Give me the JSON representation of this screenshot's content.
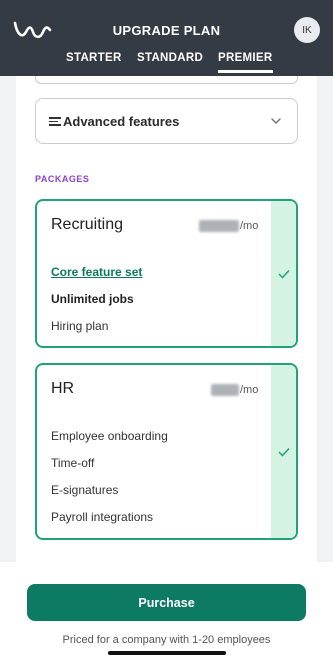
{
  "header": {
    "title": "UPGRADE PLAN",
    "avatar_initials": "IK",
    "tabs": [
      {
        "label": "STARTER",
        "active": false
      },
      {
        "label": "STANDARD",
        "active": false
      },
      {
        "label": "PREMIER",
        "active": true
      }
    ]
  },
  "advanced": {
    "label": "Advanced features",
    "icon": "list-icon",
    "chevron": "chevron-down-icon"
  },
  "packages": {
    "section_label": "PACKAGES",
    "items": [
      {
        "name": "Recruiting",
        "price_suffix": "/mo",
        "selected": true,
        "features": [
          "Core feature set",
          "Unlimited jobs",
          "Hiring plan"
        ]
      },
      {
        "name": "HR",
        "price_suffix": "/mo",
        "selected": true,
        "features": [
          "Employee onboarding",
          "Time-off",
          "E-signatures",
          "Payroll integrations"
        ]
      }
    ]
  },
  "footer": {
    "purchase_label": "Purchase",
    "priced_note": "Priced for a company with 1-20 employees"
  },
  "colors": {
    "header_bg": "#353b45",
    "accent_green": "#22a27b",
    "button_green": "#0d7a64",
    "packages_purple": "#8c3fd0",
    "selected_strip": "#d5f3e2"
  }
}
